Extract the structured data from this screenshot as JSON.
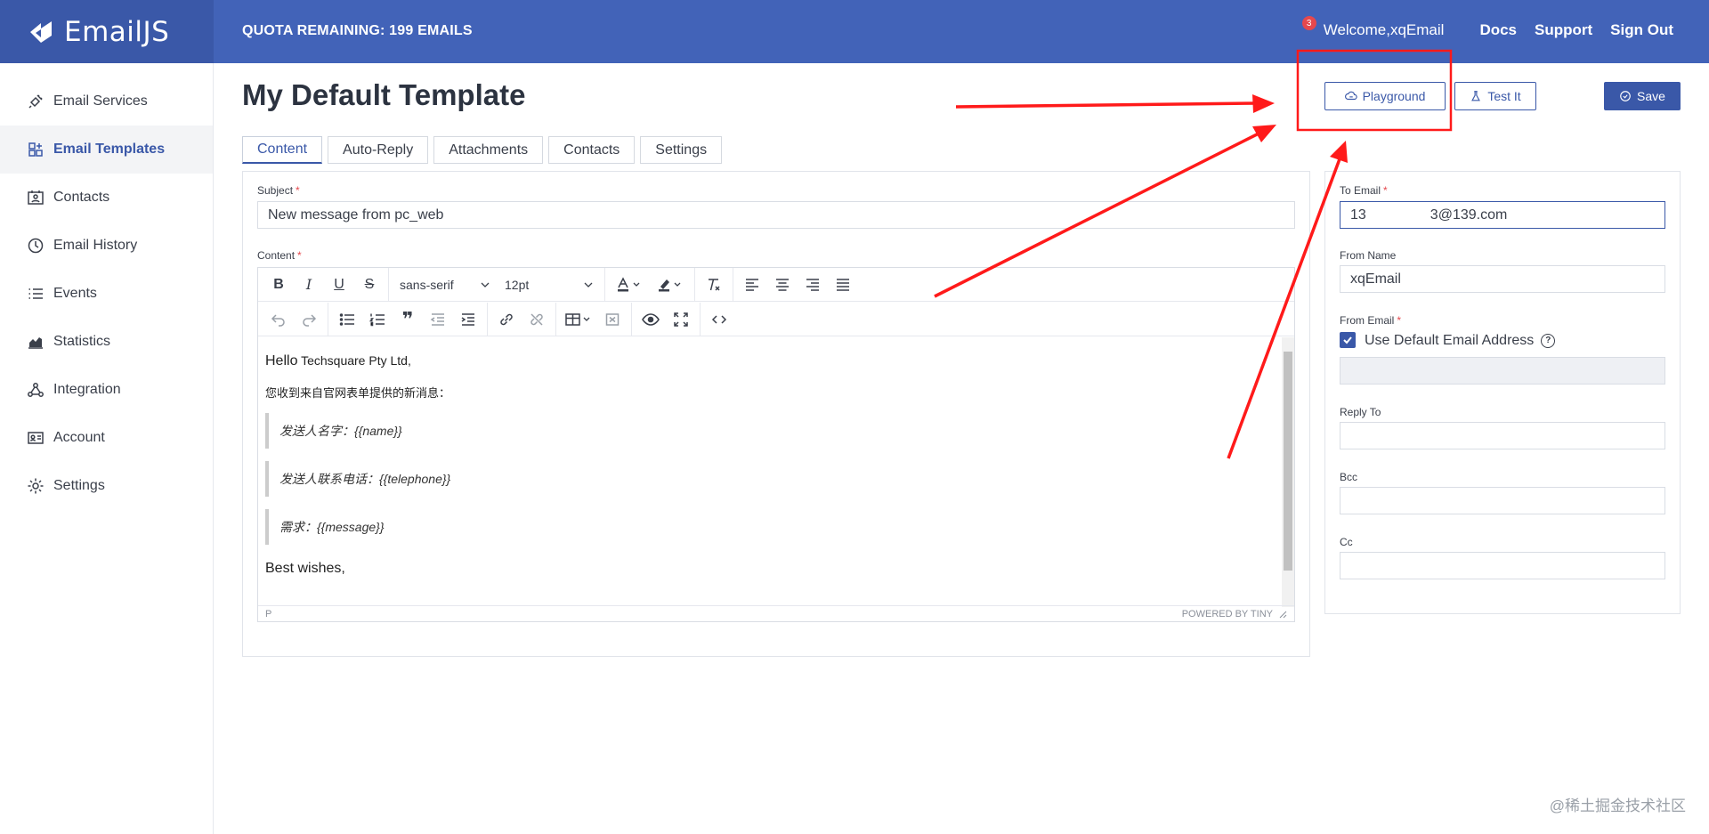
{
  "header": {
    "logo_text": "EmailJS",
    "quota": "QUOTA REMAINING: 199 EMAILS",
    "notification_count": "3",
    "welcome_label": "Welcome,",
    "username": "xqEmail",
    "links": [
      "Docs",
      "Support",
      "Sign Out"
    ]
  },
  "sidebar": {
    "items": [
      {
        "label": "Email Services",
        "icon": "plug-icon"
      },
      {
        "label": "Email Templates",
        "icon": "templates-icon",
        "active": true
      },
      {
        "label": "Contacts",
        "icon": "contacts-icon"
      },
      {
        "label": "Email History",
        "icon": "history-icon"
      },
      {
        "label": "Events",
        "icon": "list-icon"
      },
      {
        "label": "Statistics",
        "icon": "chart-icon"
      },
      {
        "label": "Integration",
        "icon": "integration-icon"
      },
      {
        "label": "Account",
        "icon": "id-card-icon"
      },
      {
        "label": "Settings",
        "icon": "gear-icon"
      }
    ]
  },
  "page": {
    "title": "My Default Template",
    "buttons": {
      "playground": "Playground",
      "test_it": "Test It",
      "save": "Save"
    },
    "tabs": [
      "Content",
      "Auto-Reply",
      "Attachments",
      "Contacts",
      "Settings"
    ]
  },
  "form": {
    "subject_label": "Subject",
    "subject_value": "New message from pc_web",
    "content_label": "Content",
    "to_email_label": "To Email",
    "to_email_value": "13         3@139.com",
    "from_name_label": "From Name",
    "from_name_value": "xqEmail",
    "from_email_label": "From Email",
    "use_default_label": "Use Default Email Address",
    "reply_to_label": "Reply To",
    "bcc_label": "Bcc",
    "cc_label": "Cc"
  },
  "editor": {
    "font_family": "sans-serif",
    "font_size": "12pt",
    "greeting_word": "Hello",
    "greeting_name": "Techsquare Pty Ltd,",
    "intro": "您收到来自官网表单提供的新消息：",
    "quotes": [
      "发送人名字：{{name}}",
      "发送人联系电话：{{telephone}}",
      "需求：{{message}}"
    ],
    "closing": "Best wishes,",
    "status_path": "P",
    "powered_by": "POWERED BY TINY"
  },
  "watermark": "@稀土掘金技术社区",
  "colors": {
    "header_bg": "#4263b8",
    "accent": "#3a58a8",
    "required": "#e5484d",
    "annotation": "#ff1a1a"
  }
}
